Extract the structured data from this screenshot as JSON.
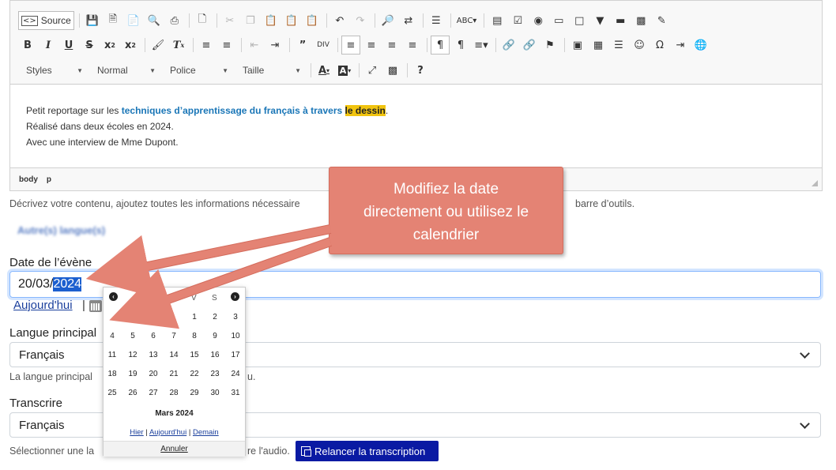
{
  "toolbar": {
    "source_label": "Source",
    "styles_label": "Styles",
    "format_label": "Normal",
    "font_label": "Police",
    "size_label": "Taille"
  },
  "editor": {
    "line1_before": "Petit reportage sur les ",
    "line1_blue": "techniques d’apprentissage du français à travers",
    "line1_space": " ",
    "line1_yellow": "le dessin",
    "line1_after": ".",
    "line2": "Réalisé dans deux écoles en 2024.",
    "line3": "Avec une interview de Mme Dupont.",
    "path": [
      "body",
      "p"
    ]
  },
  "form": {
    "help_text_left": "Décrivez votre contenu, ajoutez toutes les informations nécessaire",
    "help_text_right": "barre d’outils.",
    "other_lang": "Autre(s) langue(s)",
    "date_label": "Date de l’évène",
    "date_value_prefix": "20/03/",
    "date_value_selected": "2024",
    "today_link": "Aujourd'hui",
    "pipe": "|",
    "lang_label": "Langue principal",
    "lang_value": "Français",
    "lang_note_left": "La langue principal",
    "lang_note_right": "u.",
    "transcribe_label": "Transcrire",
    "transcribe_value": "Français",
    "transcribe_note_left": "Sélectionner une la",
    "transcribe_note_right": "re l'audio.",
    "relaunch_button": "Relancer la transcription"
  },
  "calendar": {
    "prev": "‹",
    "next": "›",
    "day_headers_visible": [
      "V",
      "S"
    ],
    "weeks": [
      [
        "",
        "",
        "",
        "",
        "1",
        "2",
        "3"
      ],
      [
        "4",
        "5",
        "6",
        "7",
        "8",
        "9",
        "10"
      ],
      [
        "11",
        "12",
        "13",
        "14",
        "15",
        "16",
        "17"
      ],
      [
        "18",
        "19",
        "20",
        "21",
        "22",
        "23",
        "24"
      ],
      [
        "25",
        "26",
        "27",
        "28",
        "29",
        "30",
        "31"
      ]
    ],
    "month_label": "Mars 2024",
    "yesterday": "Hier",
    "today": "Aujourd'hui",
    "tomorrow": "Demain",
    "sep": "|",
    "cancel": "Annuler"
  },
  "callout": {
    "line1": "Modifiez la date",
    "line2": "directement ou utilisez le",
    "line3": "calendrier"
  },
  "colors": {
    "callout_bg": "#e48374",
    "link_blue": "#1a76b7",
    "highlight_yellow": "#f1c40f",
    "button_navy": "#0a1aa3"
  }
}
